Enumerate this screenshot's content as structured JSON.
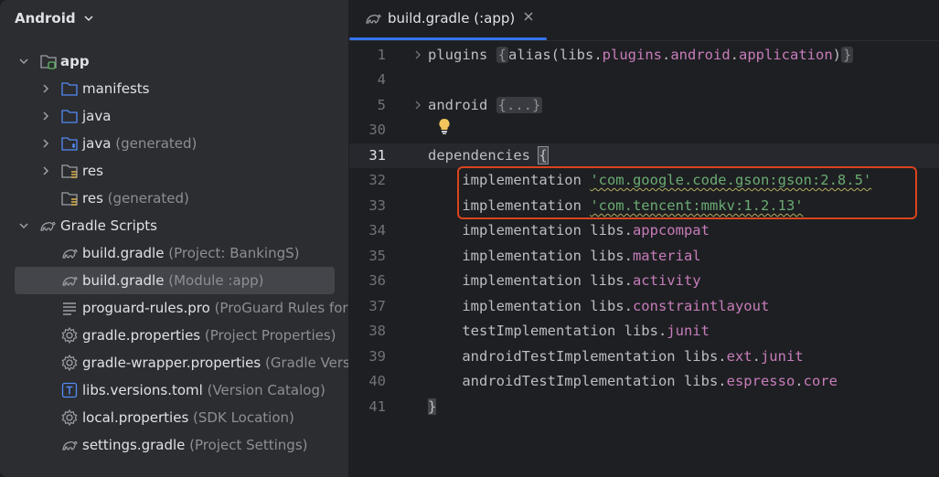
{
  "sidebar": {
    "header": "Android",
    "items": [
      {
        "label": "app",
        "secondary": ""
      },
      {
        "label": "manifests",
        "secondary": ""
      },
      {
        "label": "java",
        "secondary": ""
      },
      {
        "label": "java",
        "secondary": "(generated)"
      },
      {
        "label": "res",
        "secondary": ""
      },
      {
        "label": "res",
        "secondary": "(generated)"
      },
      {
        "label": "Gradle Scripts",
        "secondary": ""
      },
      {
        "label": "build.gradle",
        "secondary": "(Project: BankingS)"
      },
      {
        "label": "build.gradle",
        "secondary": "(Module :app)"
      },
      {
        "label": "proguard-rules.pro",
        "secondary": "(ProGuard Rules for"
      },
      {
        "label": "gradle.properties",
        "secondary": "(Project Properties)"
      },
      {
        "label": "gradle-wrapper.properties",
        "secondary": "(Gradle Versi"
      },
      {
        "label": "libs.versions.toml",
        "secondary": "(Version Catalog)"
      },
      {
        "label": "local.properties",
        "secondary": "(SDK Location)"
      },
      {
        "label": "settings.gradle",
        "secondary": "(Project Settings)"
      }
    ]
  },
  "editor": {
    "tab": {
      "label": "build.gradle (:app)"
    },
    "lines": [
      {
        "num": "1",
        "parts": [
          "plugins ",
          "{",
          "alias(libs.",
          "plugins",
          ".",
          "android",
          ".",
          "application",
          ")",
          "}"
        ]
      },
      {
        "num": "4"
      },
      {
        "num": "5",
        "parts": [
          "android ",
          "{...}"
        ]
      },
      {
        "num": "30"
      },
      {
        "num": "31",
        "parts": [
          "dependencies ",
          "{"
        ]
      },
      {
        "num": "32",
        "parts": [
          "    implementation ",
          "'com.google.code.gson:gson:2.8.5'"
        ]
      },
      {
        "num": "33",
        "parts": [
          "    implementation ",
          "'com.tencent:mmkv:1.2.13'"
        ]
      },
      {
        "num": "34",
        "parts": [
          "    implementation libs.",
          "appcompat"
        ]
      },
      {
        "num": "35",
        "parts": [
          "    implementation libs.",
          "material"
        ]
      },
      {
        "num": "36",
        "parts": [
          "    implementation libs.",
          "activity"
        ]
      },
      {
        "num": "37",
        "parts": [
          "    implementation libs.",
          "constraintlayout"
        ]
      },
      {
        "num": "38",
        "parts": [
          "    testImplementation libs.",
          "junit"
        ]
      },
      {
        "num": "39",
        "parts": [
          "    androidTestImplementation libs.",
          "ext",
          ".",
          "junit"
        ]
      },
      {
        "num": "40",
        "parts": [
          "    androidTestImplementation libs.",
          "espresso",
          ".",
          "core"
        ]
      },
      {
        "num": "41",
        "parts": [
          "}"
        ]
      }
    ]
  },
  "colors": {
    "accent": "#3574f0",
    "string": "#6aab73",
    "property": "#c77dbb",
    "highlight_box": "#d9441e"
  }
}
